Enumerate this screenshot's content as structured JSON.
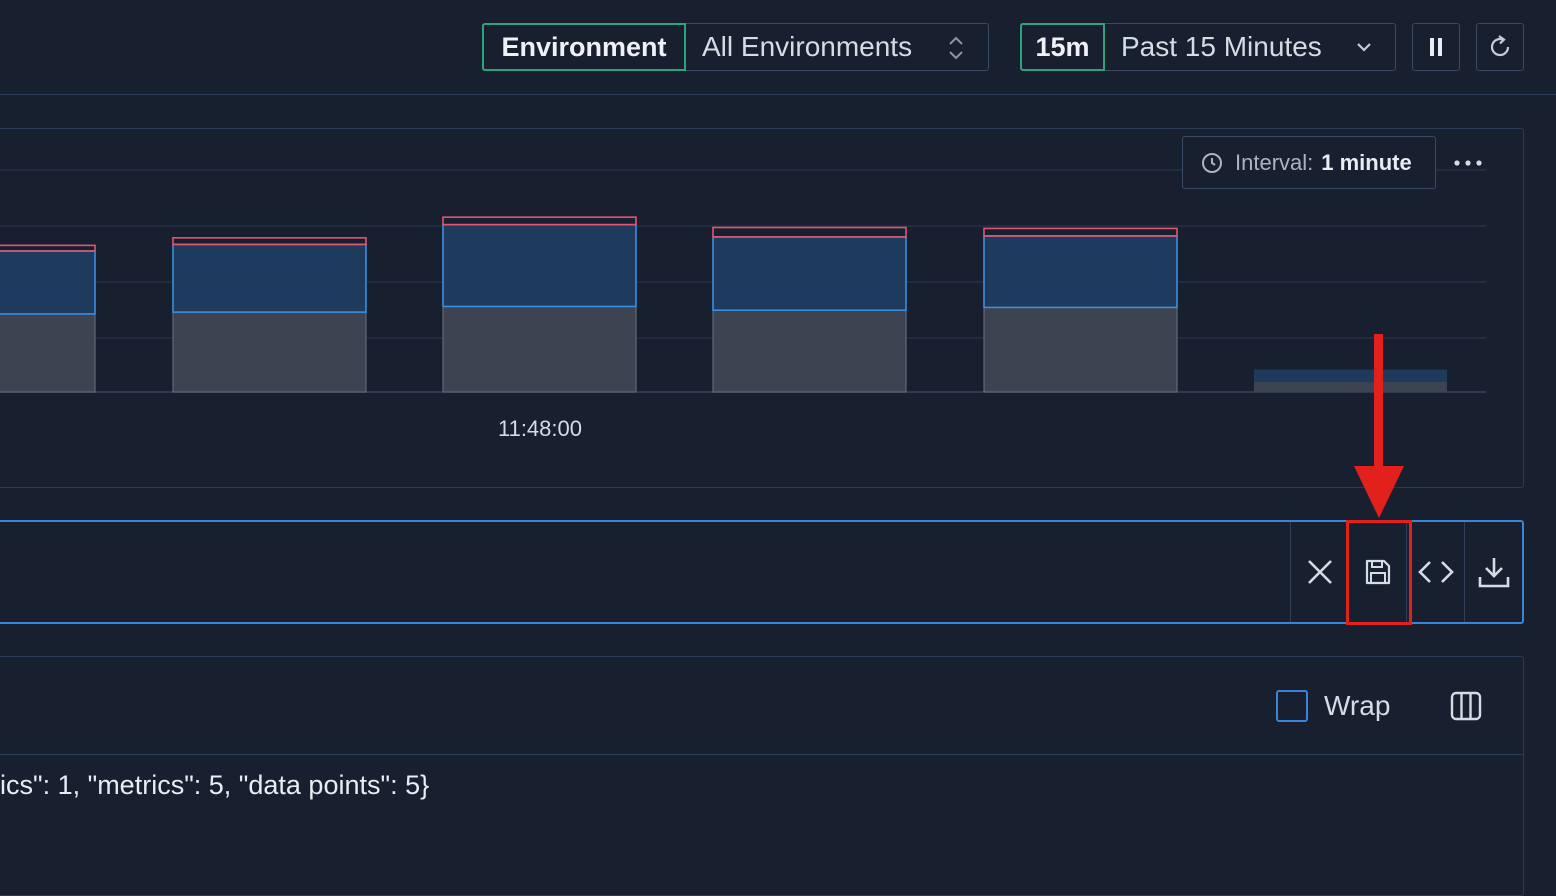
{
  "topbar": {
    "environment_label": "Environment",
    "environment_value": "All Environments",
    "time_short": "15m",
    "time_range": "Past 15 Minutes",
    "pause_icon": "pause-icon",
    "refresh_icon": "refresh-icon"
  },
  "chart": {
    "interval_label": "Interval:",
    "interval_value": "1 minute",
    "more_icon": "more-horizontal-icon",
    "x_tick_label": "11:48:00"
  },
  "chart_data": {
    "type": "bar",
    "stacked": true,
    "categories": [
      "",
      "",
      "11:48:00",
      "",
      "",
      ""
    ],
    "series": [
      {
        "color": "#3d4350",
        "values": [
          83,
          85,
          91,
          87,
          90,
          11
        ]
      },
      {
        "color": "#1e3a5c",
        "values": [
          67,
          72,
          87,
          78,
          76,
          13
        ]
      },
      {
        "color": "#e0566e",
        "values": [
          6,
          7,
          8,
          10,
          8,
          0
        ]
      }
    ],
    "grid": true,
    "legend": "none"
  },
  "query_bar": {
    "close_icon": "close-icon",
    "save_icon": "save-icon",
    "code_icon": "code-icon",
    "download_icon": "download-icon"
  },
  "results": {
    "wrap_label": "Wrap",
    "columns_icon": "columns-icon",
    "line": "ics\": 1, \"metrics\": 5, \"data points\": 5}"
  },
  "colors": {
    "background": "#182030",
    "accent_green": "#2aa57b",
    "accent_blue": "#3b82d9",
    "highlight_red": "#e3211c"
  }
}
